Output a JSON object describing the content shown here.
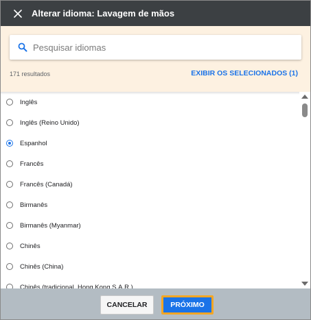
{
  "header": {
    "title": "Alterar idioma: Lavagem de mãos",
    "close_icon": "close-icon"
  },
  "search": {
    "placeholder": "Pesquisar idiomas",
    "value": "",
    "icon": "search-icon"
  },
  "results": {
    "count_label": "171 resultados",
    "show_selected_label": "EXIBIR OS SELECIONADOS (1)"
  },
  "languages": [
    {
      "label": "Inglês",
      "selected": false
    },
    {
      "label": "Inglês (Reino Unido)",
      "selected": false
    },
    {
      "label": "Espanhol",
      "selected": true
    },
    {
      "label": "Francês",
      "selected": false
    },
    {
      "label": "Francês (Canadá)",
      "selected": false
    },
    {
      "label": "Birmanês",
      "selected": false
    },
    {
      "label": "Birmanês (Myanmar)",
      "selected": false
    },
    {
      "label": "Chinês",
      "selected": false
    },
    {
      "label": "Chinês (China)",
      "selected": false
    },
    {
      "label": "Chinês (tradicional, Hong Kong S.A.R.)",
      "selected": false
    }
  ],
  "footer": {
    "cancel_label": "CANCELAR",
    "next_label": "PRÓXIMO"
  },
  "colors": {
    "header_bg": "#3c4043",
    "search_panel_bg": "#fdf1e1",
    "accent": "#1a73e8",
    "footer_bg": "#b3bcc3",
    "focus_outline": "#f5a623"
  }
}
